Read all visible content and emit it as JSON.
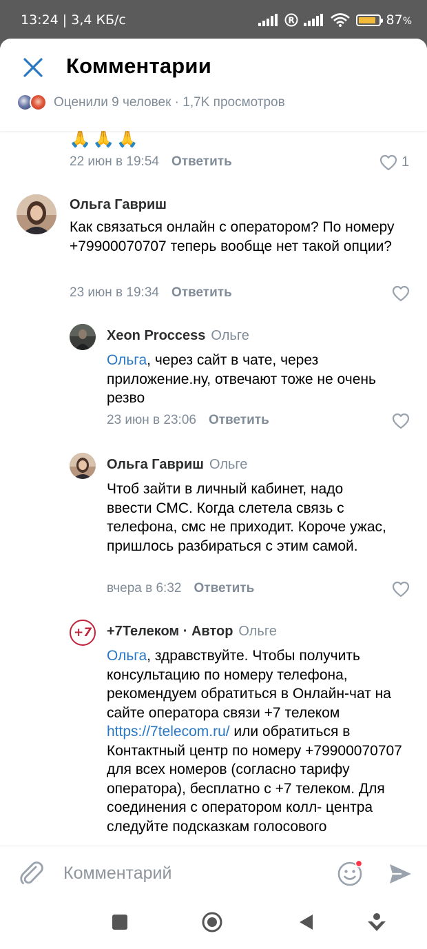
{
  "status_bar": {
    "time_speed": "13:24 | 3,4 КБ/с",
    "battery": "87",
    "battery_unit": "%",
    "battery_level": 0.87
  },
  "header": {
    "title": "Комментарии",
    "meta": "Оценили 9 человек · 1,7K просмотров"
  },
  "comments": [
    {
      "emoji": "🙏🙏🙏",
      "date": "22 июн в 19:54",
      "reply_label": "Ответить",
      "likes": "1"
    },
    {
      "author": "Ольга Гавриш",
      "text": "Как связаться онлайн с оператором? По номеру +79900070707 теперь вообще нет такой опции?",
      "date": "23 июн в 19:34",
      "reply_label": "Ответить"
    }
  ],
  "replies": [
    {
      "author": "Xeon Proccess",
      "reply_to": "Ольге",
      "mention": "Ольга",
      "text": ", через сайт в чате, через приложение.ну, отвечают тоже не очень резво",
      "date": "23 июн в 23:06",
      "reply_label": "Ответить"
    },
    {
      "author": "Ольга Гавриш",
      "reply_to": "Ольге",
      "text": "Чтоб зайти в личный кабинет, надо ввести СМС. Когда слетела связь с телефона, смс не приходит. Короче ужас, пришлось разбираться с этим самой.",
      "date": "вчера в 6:32",
      "reply_label": "Ответить"
    },
    {
      "author": "+7Телеком · Автор",
      "reply_to": "Ольге",
      "mention": "Ольга",
      "text_before_link": ", здравствуйте. Чтобы получить консультацию по номеру телефона, рекомендуем обратиться в Онлайн-чат на сайте оператора связи +7 телеком ",
      "link": "https://7telecom.ru/",
      "text_after_link": " или обратиться в Контактный центр по номеру +79900070707 для всех номеров (согласно тарифу оператора), бесплатно с +7 телеком. Для соединения с оператором колл- центра следуйте подсказкам голосового",
      "logo_text": "+7"
    }
  ],
  "input": {
    "placeholder": "Комментарий"
  },
  "icons": {
    "close": "close-icon",
    "attach": "paperclip-icon",
    "emoji": "emoji-icon",
    "send": "send-icon",
    "like": "heart-icon"
  },
  "colors": {
    "accent": "#2a78c4",
    "secondary_text": "#818c99",
    "telecom_red": "#c0243b"
  }
}
